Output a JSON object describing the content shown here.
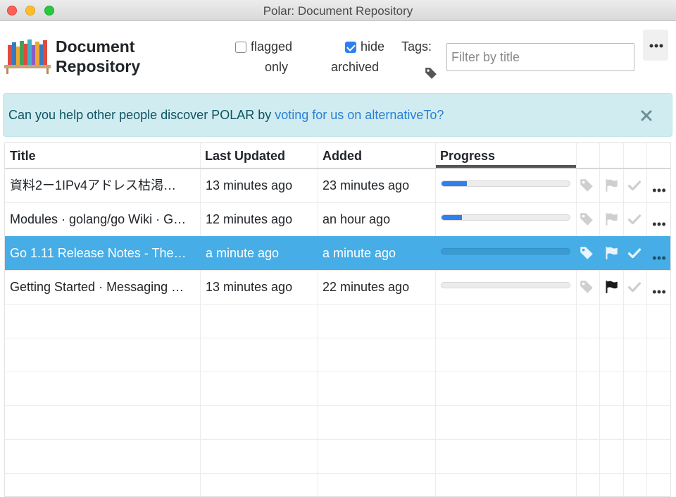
{
  "window": {
    "title": "Polar: Document Repository"
  },
  "header": {
    "title_line1": "Document",
    "title_line2": "Repository",
    "flagged_label_1": "flagged",
    "flagged_label_2": "only",
    "flagged_checked": false,
    "hide_label_1": "hide",
    "hide_label_2": "archived",
    "hide_checked": true,
    "tags_label": "Tags:",
    "filter_placeholder": "Filter by title",
    "filter_value": ""
  },
  "alert": {
    "text": "Can you help other people discover POLAR by ",
    "link_text": "voting for us on alternativeTo?"
  },
  "table": {
    "columns": [
      "Title",
      "Last Updated",
      "Added",
      "Progress"
    ],
    "rows": [
      {
        "title": "資料2ー1IPv4アドレス枯渇…",
        "updated": "13 minutes ago",
        "added": "23 minutes ago",
        "progress": 0.2,
        "flagged": false,
        "selected": false
      },
      {
        "title": "Modules · golang/go Wiki · G…",
        "updated": "12 minutes ago",
        "added": "an hour ago",
        "progress": 0.16,
        "flagged": false,
        "selected": false
      },
      {
        "title": "Go 1.11 Release Notes - The…",
        "updated": "a minute ago",
        "added": "a minute ago",
        "progress": 0.0,
        "flagged": false,
        "selected": true
      },
      {
        "title": "Getting Started · Messaging …",
        "updated": "13 minutes ago",
        "added": "22 minutes ago",
        "progress": 0.0,
        "flagged": true,
        "selected": false
      }
    ]
  },
  "colors": {
    "accent": "#2f80ed",
    "selected_row": "#46ade6",
    "alert_bg": "#d1ecf1",
    "alert_link": "#2a7fd4"
  },
  "icons": [
    "tag-icon",
    "flag-icon",
    "check-icon",
    "more-icon",
    "close-icon",
    "books-logo"
  ]
}
